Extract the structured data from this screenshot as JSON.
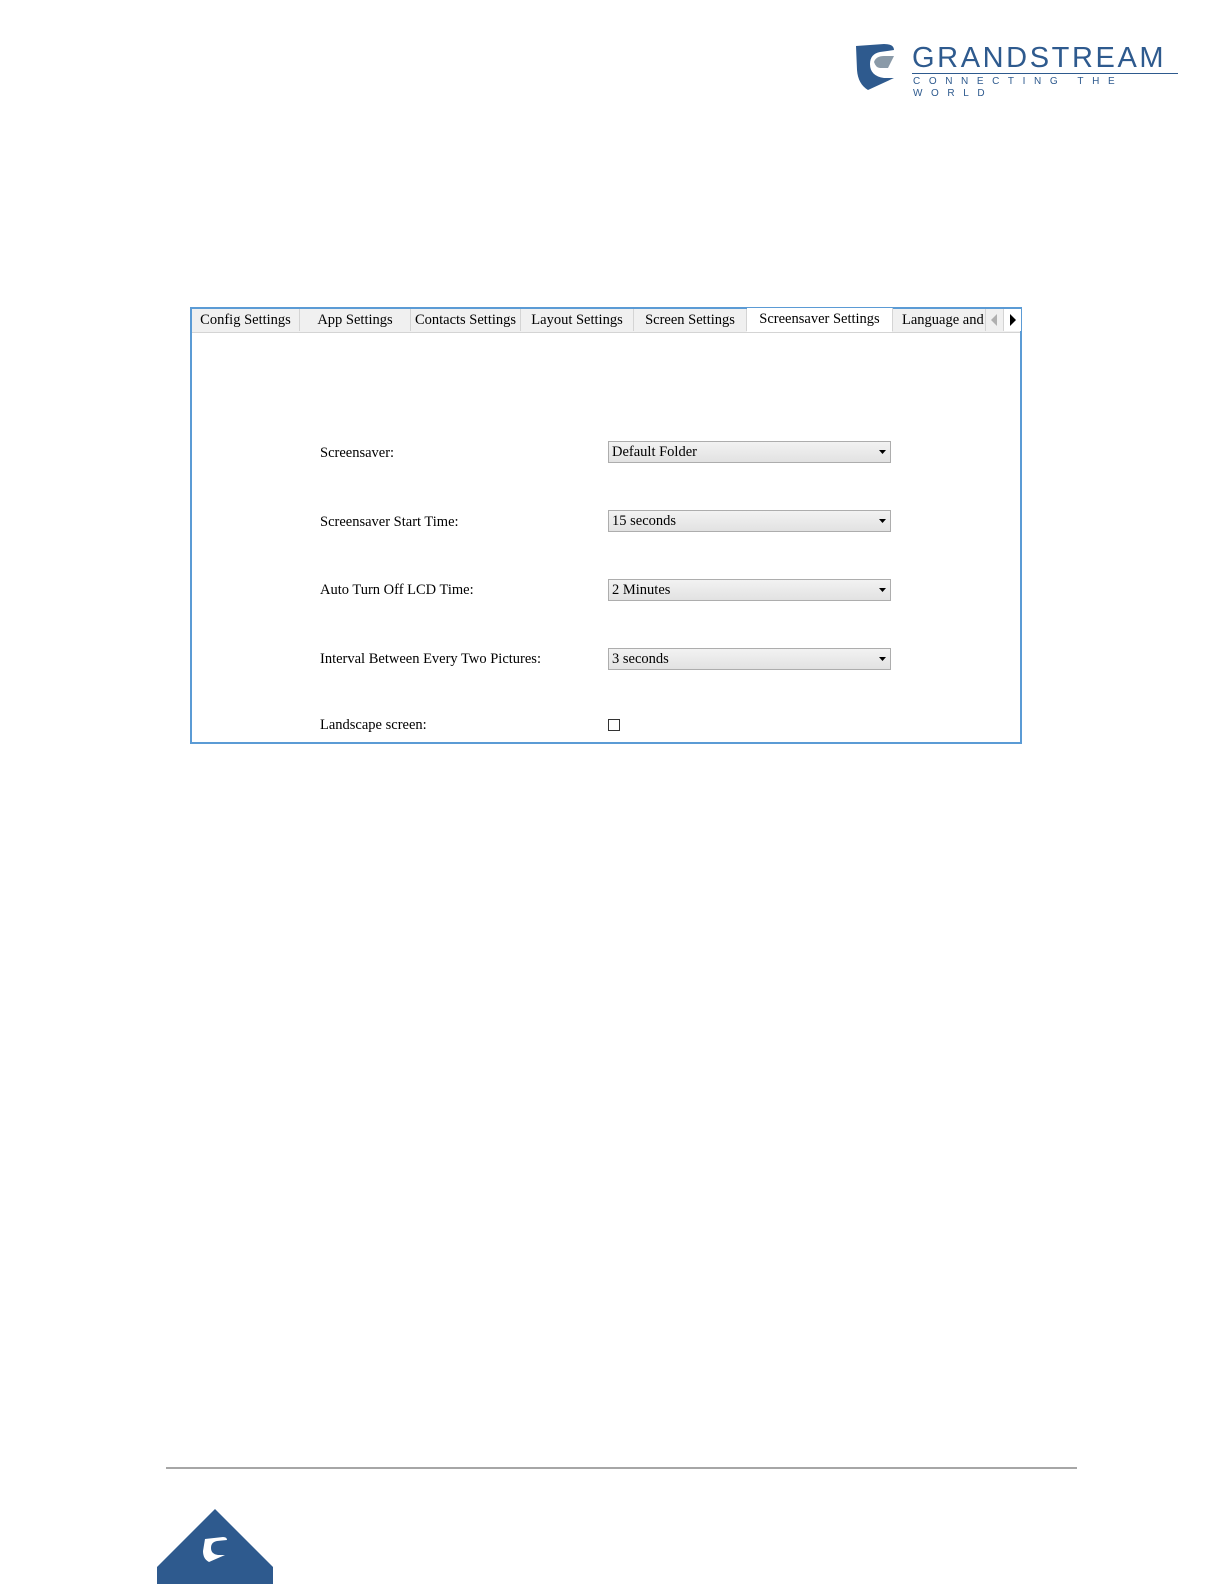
{
  "brand": {
    "name": "GRANDSTREAM",
    "tagline": "CONNECTING THE WORLD",
    "color": "#2e5a8e"
  },
  "tabs": [
    {
      "label": "Config Settings",
      "active": false
    },
    {
      "label": "App Settings",
      "active": false
    },
    {
      "label": "Contacts Settings",
      "active": false
    },
    {
      "label": "Layout Settings",
      "active": false
    },
    {
      "label": "Screen Settings",
      "active": false
    },
    {
      "label": "Screensaver Settings",
      "active": true
    },
    {
      "label": "Language and",
      "active": false
    }
  ],
  "tab_scroll": {
    "left_icon": "scroll-left-icon",
    "right_icon": "scroll-right-icon"
  },
  "settings": {
    "screensaver": {
      "label": "Screensaver:",
      "value": "Default Folder"
    },
    "start_time": {
      "label": "Screensaver Start Time:",
      "value": "15 seconds"
    },
    "lcd_off": {
      "label": "Auto Turn Off LCD Time:",
      "value": "2 Minutes"
    },
    "interval": {
      "label": "Interval Between Every Two Pictures:",
      "value": "3 seconds"
    },
    "landscape": {
      "label": "Landscape screen:",
      "checked": false
    }
  },
  "colors": {
    "panel_border": "#5b9bd5",
    "footer_badge": "#2e5a8e"
  }
}
